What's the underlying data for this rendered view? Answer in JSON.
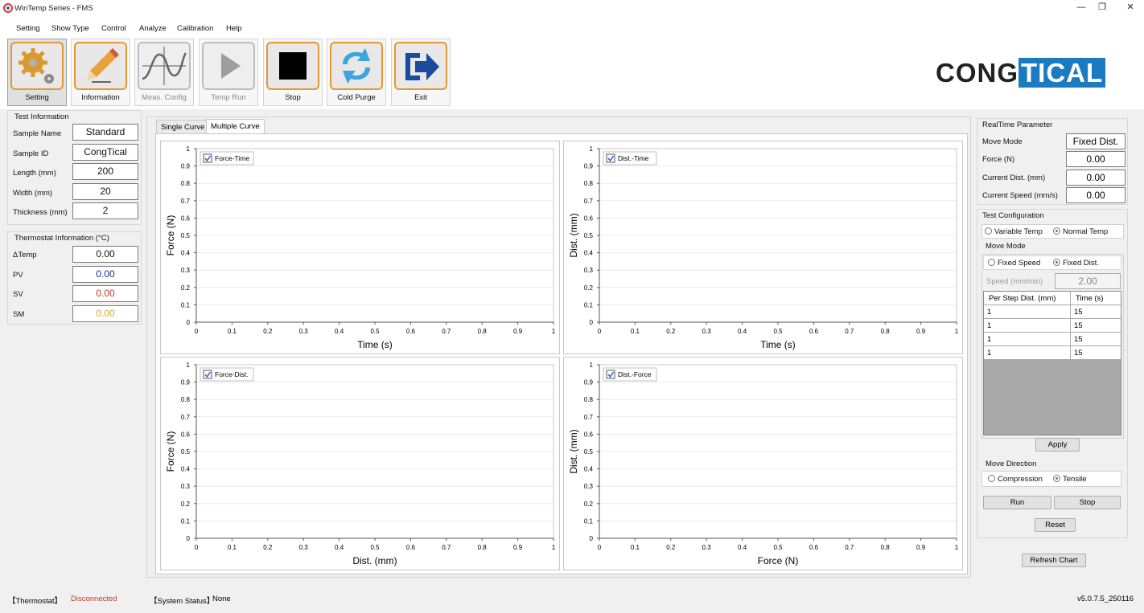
{
  "window": {
    "title": "WinTemp Series - FMS",
    "minimize": "—",
    "maximize": "❐",
    "close": "✕"
  },
  "menu": [
    "Setting",
    "Show Type",
    "Control",
    "Analyze",
    "Calibration",
    "Help"
  ],
  "toolbar": [
    {
      "label": "Setting",
      "icon": "gear-icon",
      "enabled": true
    },
    {
      "label": "Information",
      "icon": "pencil-icon",
      "enabled": true
    },
    {
      "label": "Meas. Config",
      "icon": "waveform-icon",
      "enabled": false
    },
    {
      "label": "Temp Run",
      "icon": "play-icon",
      "enabled": false
    },
    {
      "label": "Stop",
      "icon": "stop-icon",
      "enabled": true
    },
    {
      "label": "Cold Purge",
      "icon": "refresh-arrows-icon",
      "enabled": true
    },
    {
      "label": "Exit",
      "icon": "exit-arrow-icon",
      "enabled": true
    }
  ],
  "logo": {
    "part1": "CONG",
    "part2": "TICAL"
  },
  "test_info": {
    "title": "Test Information",
    "fields": [
      {
        "label": "Sample Name",
        "value": "Standard"
      },
      {
        "label": "Sample ID",
        "value": "CongTical"
      },
      {
        "label": "Length (mm)",
        "value": "200"
      },
      {
        "label": "Width (mm)",
        "value": "20"
      },
      {
        "label": "Thickness (mm)",
        "value": "2"
      }
    ]
  },
  "thermostat": {
    "title": "Thermostat Information (°C)",
    "fields": [
      {
        "label": "ΔTemp",
        "value": "0.00",
        "color": "#111111"
      },
      {
        "label": "PV",
        "value": "0.00",
        "color": "#1f2b8f"
      },
      {
        "label": "SV",
        "value": "0.00",
        "color": "#c0392b"
      },
      {
        "label": "SM",
        "value": "0.00",
        "color": "#e0a030"
      }
    ]
  },
  "tabs": [
    {
      "label": "Single Curve",
      "selected": false
    },
    {
      "label": "Multiple Curve",
      "selected": true
    }
  ],
  "chart_data": [
    {
      "type": "line",
      "legend": "Force-Time",
      "xlabel": "Time (s)",
      "ylabel": "Force (N)",
      "xlim": [
        0,
        1
      ],
      "ylim": [
        0,
        1
      ],
      "xticks": [
        "0",
        "0.1",
        "0.2",
        "0.3",
        "0.4",
        "0.5",
        "0.6",
        "0.7",
        "0.8",
        "0.9",
        "1"
      ],
      "yticks": [
        "0",
        "0.1",
        "0.2",
        "0.3",
        "0.4",
        "0.5",
        "0.6",
        "0.7",
        "0.8",
        "0.9",
        "1"
      ],
      "series": []
    },
    {
      "type": "line",
      "legend": "Dist.-Time",
      "xlabel": "Time (s)",
      "ylabel": "Dist. (mm)",
      "xlim": [
        0,
        1
      ],
      "ylim": [
        0,
        1
      ],
      "xticks": [
        "0",
        "0.1",
        "0.2",
        "0.3",
        "0.4",
        "0.5",
        "0.6",
        "0.7",
        "0.8",
        "0.9",
        "1"
      ],
      "yticks": [
        "0",
        "0.1",
        "0.2",
        "0.3",
        "0.4",
        "0.5",
        "0.6",
        "0.7",
        "0.8",
        "0.9",
        "1"
      ],
      "series": []
    },
    {
      "type": "line",
      "legend": "Force-Dist.",
      "xlabel": "Dist. (mm)",
      "ylabel": "Force (N)",
      "xlim": [
        0,
        1
      ],
      "ylim": [
        0,
        1
      ],
      "xticks": [
        "0",
        "0.1",
        "0.2",
        "0.3",
        "0.4",
        "0.5",
        "0.6",
        "0.7",
        "0.8",
        "0.9",
        "1"
      ],
      "yticks": [
        "0",
        "0.1",
        "0.2",
        "0.3",
        "0.4",
        "0.5",
        "0.6",
        "0.7",
        "0.8",
        "0.9",
        "1"
      ],
      "series": []
    },
    {
      "type": "line",
      "legend": "Dist.-Force",
      "xlabel": "Force (N)",
      "ylabel": "Dist. (mm)",
      "xlim": [
        0,
        1
      ],
      "ylim": [
        0,
        1
      ],
      "xticks": [
        "0",
        "0.1",
        "0.2",
        "0.3",
        "0.4",
        "0.5",
        "0.6",
        "0.7",
        "0.8",
        "0.9",
        "1"
      ],
      "yticks": [
        "0",
        "0.1",
        "0.2",
        "0.3",
        "0.4",
        "0.5",
        "0.6",
        "0.7",
        "0.8",
        "0.9",
        "1"
      ],
      "series": []
    }
  ],
  "realtime": {
    "title": "RealTime Parameter",
    "fields": [
      {
        "label": "Move Mode",
        "value": "Fixed Dist."
      },
      {
        "label": "Force (N)",
        "value": "0.00"
      },
      {
        "label": "Current Dist. (mm)",
        "value": "0.00"
      },
      {
        "label": "Current Speed (mm/s)",
        "value": "0.00"
      }
    ]
  },
  "test_config": {
    "title": "Test Configuration",
    "temp_modes": [
      {
        "label": "Variable Temp",
        "selected": false
      },
      {
        "label": "Normal Temp",
        "selected": true
      }
    ],
    "move_mode_title": "Move Mode",
    "move_modes": [
      {
        "label": "Fixed Speed",
        "selected": false
      },
      {
        "label": "Fixed Dist.",
        "selected": true
      }
    ],
    "speed_label": "Speed (mm/min)",
    "speed_value": "2.00",
    "table": {
      "headers": [
        "Per Step Dist. (mm)",
        "Time (s)"
      ],
      "rows": [
        [
          "1",
          "15"
        ],
        [
          "1",
          "15"
        ],
        [
          "1",
          "15"
        ],
        [
          "1",
          "15"
        ]
      ]
    },
    "apply": "Apply",
    "direction_title": "Move Direction",
    "directions": [
      {
        "label": "Compression",
        "selected": false
      },
      {
        "label": "Tensile",
        "selected": true
      }
    ],
    "run": "Run",
    "stop": "Stop",
    "reset": "Reset"
  },
  "refresh_chart": "Refresh Chart",
  "status": {
    "thermostat_label": "【Thermostat】",
    "thermostat_value": "Disconnected",
    "system_label": "【System Status】",
    "system_value": "None",
    "version": "v5.0.7.5_250116"
  }
}
